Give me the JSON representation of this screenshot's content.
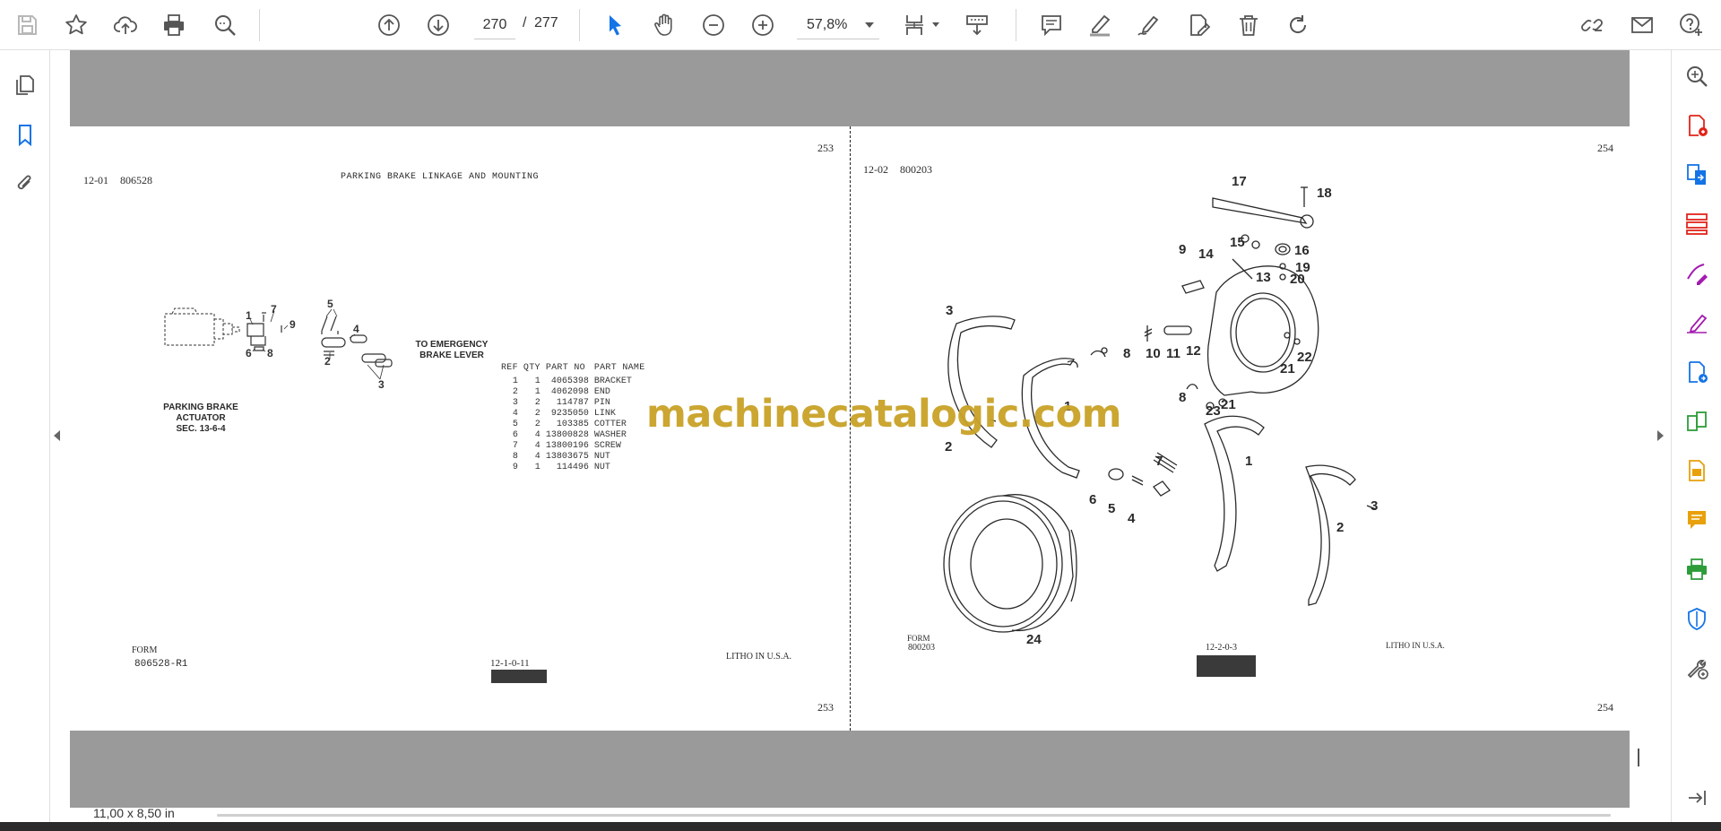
{
  "toolbar": {
    "page_current": "270",
    "page_separator": "/",
    "page_total": "277",
    "zoom": "57,8%",
    "icons_left": [
      "save-icon",
      "star-icon",
      "upload-cloud-icon",
      "print-icon",
      "find-icon"
    ],
    "icons_nav": [
      "page-up-icon",
      "page-down-icon"
    ],
    "icons_tools": [
      "select-cursor-icon",
      "hand-icon",
      "zoom-out-icon",
      "zoom-in-icon"
    ],
    "icons_view": [
      "fit-page-icon",
      "scroll-mode-icon"
    ],
    "icons_annot": [
      "comment-icon",
      "highlight-icon",
      "draw-icon",
      "fill-sign-icon",
      "delete-icon",
      "rotate-icon"
    ],
    "icons_right": [
      "share-link-icon",
      "email-icon",
      "account-help-icon"
    ],
    "accent": "#1473e6"
  },
  "left_panel": {
    "icons": [
      "page-thumbnails-icon",
      "bookmarks-icon",
      "attachments-icon"
    ]
  },
  "right_panel": {
    "icons": [
      "search-zoom-icon",
      "create-pdf-icon",
      "export-pdf-icon",
      "organize-pages-icon",
      "edit-pdf-icon",
      "fill-and-sign-icon",
      "send-for-review-icon",
      "compress-icon",
      "scan-ocr-icon",
      "comment-panel-icon",
      "print-production-icon",
      "protect-icon",
      "more-tools-icon",
      "collapse-panel-icon"
    ]
  },
  "status": {
    "page_size": "11,00 x 8,50 in"
  },
  "watermark": "machinecatalogic.com",
  "page_left": {
    "page_number_top": "253",
    "page_number_bottom": "253",
    "code": "12-01",
    "doc_number": "806528",
    "title": "PARKING BRAKE LINKAGE AND MOUNTING",
    "label_actuator": "PARKING BRAKE\nACTUATOR\nSEC. 13-6-4",
    "label_lever": "TO EMERGENCY\nBRAKE LEVER",
    "callouts": [
      "1",
      "7",
      "9",
      "6",
      "8",
      "5",
      "4",
      "2",
      "3"
    ],
    "table_headers": [
      "REF",
      "QTY",
      "PART NO",
      "PART NAME"
    ],
    "table_rows": [
      [
        "1",
        "1",
        "4065398",
        "BRACKET"
      ],
      [
        "2",
        "1",
        "4062098",
        "END"
      ],
      [
        "3",
        "2",
        "114787",
        "PIN"
      ],
      [
        "4",
        "2",
        "9235050",
        "LINK"
      ],
      [
        "5",
        "2",
        "103385",
        "COTTER"
      ],
      [
        "6",
        "4",
        "13800828",
        "WASHER"
      ],
      [
        "7",
        "4",
        "13800196",
        "SCREW"
      ],
      [
        "8",
        "4",
        "13803675",
        "NUT"
      ],
      [
        "9",
        "1",
        "114496",
        "NUT"
      ]
    ],
    "form_label": "FORM",
    "form_number": "806528-R1",
    "footer_code": "12-1-0-11",
    "litho": "LITHO IN U.S.A."
  },
  "page_right": {
    "page_number_top": "254",
    "page_number_bottom": "254",
    "code": "12-02",
    "doc_number": "800203",
    "callouts": [
      "17",
      "18",
      "9",
      "14",
      "15",
      "16",
      "19",
      "20",
      "13",
      "3",
      "8",
      "10",
      "11",
      "12",
      "22",
      "21",
      "1",
      "2",
      "8",
      "23",
      "21",
      "7",
      "1",
      "6",
      "5",
      "4",
      "3",
      "2",
      "24"
    ],
    "form_label": "FORM",
    "form_number": "800203",
    "footer_code": "12-2-0-3",
    "litho": "LITHO IN U.S.A."
  }
}
